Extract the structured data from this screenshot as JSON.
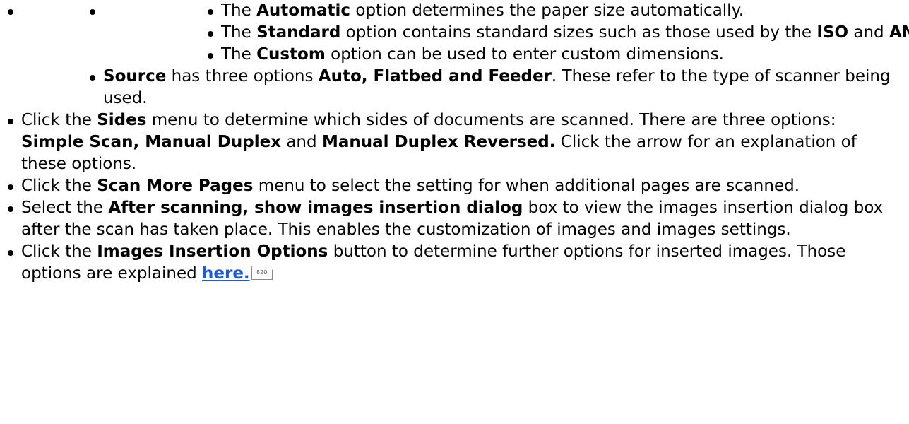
{
  "list": {
    "paper_options": [
      {
        "pre": "The ",
        "b": "Automatic",
        "post": " option determines the paper size automatically."
      },
      {
        "pre": "The ",
        "b": "Standard",
        "mid": " option contains standard sizes such as those used by the ",
        "b2": "ISO",
        "mid2": " and ",
        "b3": "ANSI",
        "post": "."
      },
      {
        "pre": "The ",
        "b": "Custom",
        "post": " option can be used to enter custom dimensions."
      }
    ],
    "source": {
      "b": "Source",
      "mid": " has three options ",
      "b2": "Auto, Flatbed and Feeder",
      "post": ". These refer to the type of scanner being used."
    },
    "sides": {
      "pre": "Click the ",
      "b": "Sides",
      "mid": " menu to determine which sides of documents are scanned. There are three options: ",
      "b2": "Simple Scan, Manual Duplex",
      "mid2": " and ",
      "b3": "Manual Duplex Reversed.",
      "post": " Click the arrow for an explanation of these options."
    },
    "scan_more": {
      "pre": "Click the ",
      "b": "Scan More Pages",
      "post": " menu to select the setting for when additional pages are scanned."
    },
    "after_scanning": {
      "pre": "Select the ",
      "b": "After scanning, show images insertion dialog",
      "post": " box to view the images insertion dialog box after the scan has taken place. This enables the customization of images and images settings."
    },
    "insertion_options": {
      "pre": "Click the ",
      "b": "Images Insertion Options",
      "post": " button to determine further options for inserted images. Those options are explained ",
      "link": "here.",
      "page_ref": "820"
    }
  }
}
